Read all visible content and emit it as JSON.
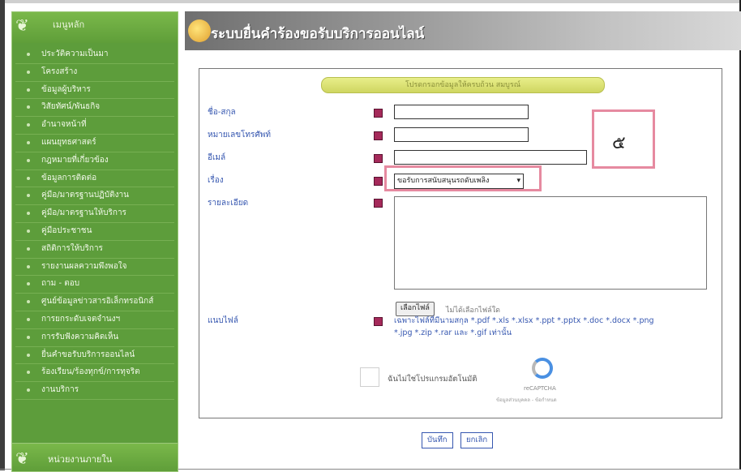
{
  "sidebar": {
    "header": "เมนูหลัก",
    "items": [
      {
        "label": "ประวัติความเป็นมา"
      },
      {
        "label": "โครงสร้าง"
      },
      {
        "label": "ข้อมูลผู้บริหาร"
      },
      {
        "label": "วิสัยทัศน์/พันธกิจ"
      },
      {
        "label": "อำนาจหน้าที่"
      },
      {
        "label": "แผนยุทธศาสตร์"
      },
      {
        "label": "กฎหมายที่เกี่ยวข้อง"
      },
      {
        "label": "ข้อมูลการติดต่อ"
      },
      {
        "label": "คู่มือ/มาตรฐานปฏิบัติงาน"
      },
      {
        "label": "คู่มือ/มาตรฐานให้บริการ"
      },
      {
        "label": "คู่มือประชาชน"
      },
      {
        "label": "สถิติการให้บริการ"
      },
      {
        "label": "รายงานผลความพึงพอใจ"
      },
      {
        "label": "ถาม - ตอบ"
      },
      {
        "label": "ศูนย์ข้อมูลข่าวสารอิเล็กทรอนิกส์"
      },
      {
        "label": "การยกระดับเจตจำนงฯ"
      },
      {
        "label": "การรับฟังความคิดเห็น"
      },
      {
        "label": "ยื่นคำขอรับบริการออนไลน์"
      },
      {
        "label": "ร้องเรียน/ร้องทุกข์/การทุจริต"
      },
      {
        "label": "งานบริการ"
      }
    ],
    "section2_header": "หน่วยงานภายใน"
  },
  "banner": {
    "title": "ระบบยื่นคำร้องขอรับบริการออนไลน์"
  },
  "form": {
    "bar_title": "โปรดกรอกข้อมูลให้ครบถ้วน สมบูรณ์",
    "name_label": "ชื่อ-สกุล",
    "phone_label": "หมายเลขโทรศัพท์",
    "email_label": "อีเมล์",
    "subject_label": "เรื่อง",
    "subject_value": "ขอรับการสนับสนุนรถดับเพลิง",
    "detail_label": "รายละเอียด",
    "attach_label": "แนบไฟล์",
    "choose_file": "เลือกไฟล์",
    "no_file": "ไม่ได้เลือกไฟล์ใด",
    "file_note_line1": "เฉพาะไฟล์ที่มีนามสกุล *.pdf *.xls *.xlsx *.ppt *.pptx *.doc *.docx *.png",
    "file_note_line2": "*.jpg *.zip *.rar และ *.gif เท่านั้น",
    "captcha_label": "ฉันไม่ใช่โปรแกรมอัตโนมัติ",
    "captcha_brand": "reCAPTCHA",
    "captcha_links": "ข้อมูลส่วนบุคคล - ข้อกำหนด",
    "save_button": "บันทึก",
    "cancel_button": "ยกเลิก"
  },
  "annotation": {
    "number": "๕"
  },
  "colors": {
    "sidebar": "#5d9d3b",
    "label": "#3657b0",
    "highlight": "#e68aa0",
    "required": "#a52a5a"
  }
}
